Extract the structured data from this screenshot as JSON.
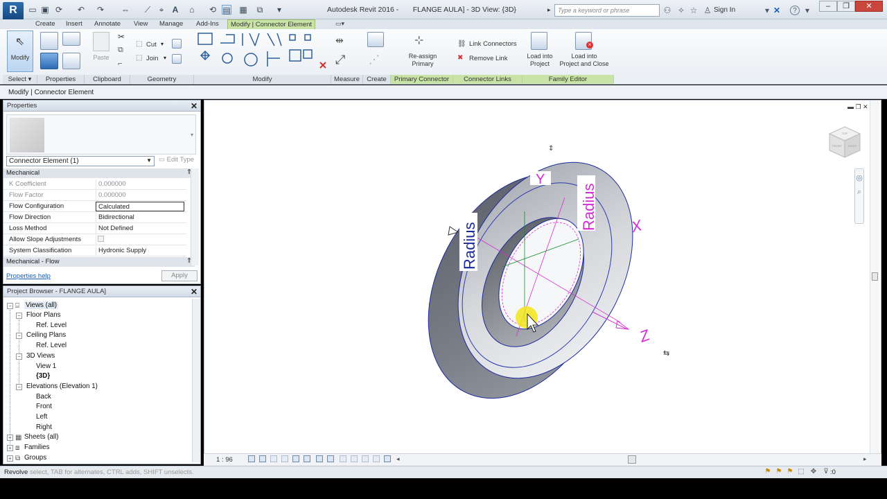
{
  "titlebar": {
    "logo": "R",
    "title": "Autodesk Revit 2016 -       FLANGE AULA] - 3D View: {3D}",
    "search_placeholder": "Type a keyword or phrase",
    "sign_in": "Sign In",
    "help": "?"
  },
  "ribbon_tabs": [
    "Create",
    "Insert",
    "Annotate",
    "View",
    "Manage",
    "Add-Ins",
    "Modify | Connector Element"
  ],
  "ribbon": {
    "modify": "Modify",
    "paste": "Paste",
    "cut": "Cut",
    "join": "Join",
    "reassign_primary": "Re-assign\nPrimary",
    "link_connectors": "Link Connectors",
    "remove_link": "Remove Link",
    "load_into_project": "Load into\nProject",
    "load_into_project_close": "Load into\nProject and Close",
    "panels": {
      "select": "Select",
      "properties": "Properties",
      "clipboard": "Clipboard",
      "geometry": "Geometry",
      "modify": "Modify",
      "measure": "Measure",
      "create": "Create",
      "primary_connector": "Primary Connector",
      "connector_links": "Connector Links",
      "family_editor": "Family Editor"
    }
  },
  "context_bar": "Modify | Connector Element",
  "properties": {
    "title": "Properties",
    "type_selector": "Connector Element (1)",
    "edit_type": "Edit Type",
    "group_mechanical": "Mechanical",
    "group_flow": "Mechanical - Flow",
    "rows": [
      {
        "name": "K Coefficient",
        "value": "0.000000"
      },
      {
        "name": "Flow Factor",
        "value": "0.000000"
      },
      {
        "name": "Flow Configuration",
        "value": "Calculated"
      },
      {
        "name": "Flow Direction",
        "value": "Bidirectional"
      },
      {
        "name": "Loss Method",
        "value": "Not Defined"
      },
      {
        "name": "Allow Slope Adjustments",
        "value": ""
      },
      {
        "name": "System Classification",
        "value": "Hydronic Supply"
      }
    ],
    "help_link": "Properties help",
    "apply": "Apply"
  },
  "browser": {
    "title": "Project Browser - FLANGE AULA]",
    "items": {
      "views_all": "Views (all)",
      "floor_plans": "Floor Plans",
      "ref_level_1": "Ref. Level",
      "ceiling_plans": "Ceiling Plans",
      "ref_level_2": "Ref. Level",
      "views_3d": "3D Views",
      "view_1": "View 1",
      "view_3d": "{3D}",
      "elevations": "Elevations (Elevation 1)",
      "back": "Back",
      "front": "Front",
      "left": "Left",
      "right": "Right",
      "sheets": "Sheets (all)",
      "families": "Families",
      "groups": "Groups"
    }
  },
  "viewport": {
    "labels": {
      "radius_left": "Radius",
      "radius_right": "Radius",
      "y_axis": "Y",
      "x_axis": "X",
      "z_axis": "Z"
    },
    "viewcube_labels": {
      "top": "TOP",
      "front": "FRONT",
      "right": "RIGHT"
    },
    "scale": "1 : 96"
  },
  "status": {
    "prefix": "Revolve",
    "hint": " select, TAB for alternates, CTRL adds, SHIFT unselects.",
    "filter_count": ":0"
  },
  "colors": {
    "accent_green": "#c9e3a6",
    "magenta": "#d42bd4",
    "blue_dark": "#1a2a9a",
    "ring_fill": "#6a6e78"
  }
}
